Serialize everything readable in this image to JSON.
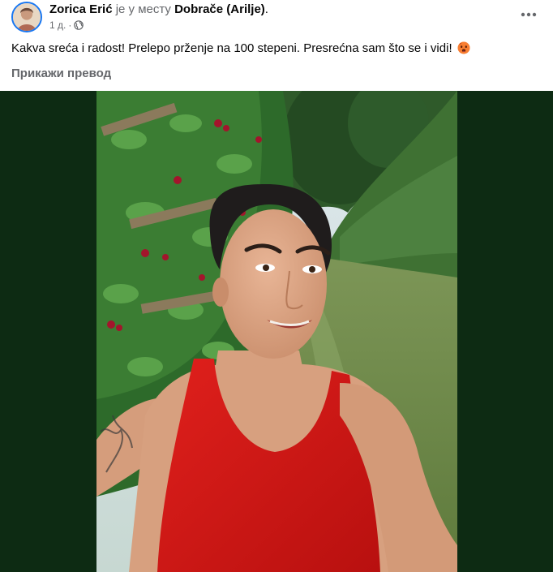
{
  "post": {
    "author": "Zorica Erić",
    "place_prefix": " је у месту ",
    "place": "Dobrače (Arilje)",
    "place_suffix": ".",
    "time": "1 д.",
    "separator": "·",
    "audience_icon": "globe-icon",
    "more_icon": "more-options-icon",
    "text": "Kakva sreća i radost! Prelepo prženje na 100 stepeni. Presrećna sam što se i vidi! ",
    "text_emoji": "hot-face-emoji",
    "translate_label": "Прикажи превод"
  },
  "colors": {
    "media_background": "#0d2b13",
    "secondary_text": "#65676b",
    "avatar_ring": "#1877f2"
  }
}
